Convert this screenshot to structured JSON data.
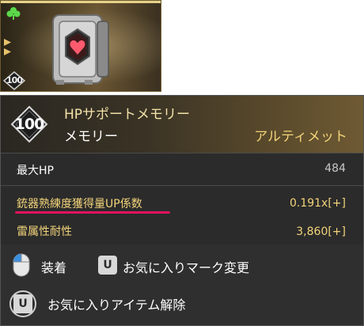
{
  "thumbnail": {
    "level": "100",
    "icon": "memory-card-heart-icon",
    "slot_icon": "clover-icon"
  },
  "tooltip": {
    "level": "100",
    "name": "HPサポートメモリー",
    "type": "メモリー",
    "rarity": "アルティメット",
    "stats": [
      {
        "label": "最大HP",
        "value": "484"
      },
      {
        "label": "銃器熟練度獲得量UP係数",
        "value": "0.191x[+]"
      },
      {
        "label": "雷属性耐性",
        "value": "3,860[+]"
      }
    ],
    "actions": {
      "equip_label": "装着",
      "equip_key": "mouse-left-click-icon",
      "favorite_mark_key": "U",
      "favorite_mark_label": "お気に入りマーク変更",
      "unfavorite_key": "U",
      "unfavorite_label": "お気に入りアイテム解除"
    }
  },
  "colors": {
    "gold_text": "#f3d47a",
    "highlight_underline": "#e0125f",
    "panel_bg": "#2b2b2b"
  }
}
